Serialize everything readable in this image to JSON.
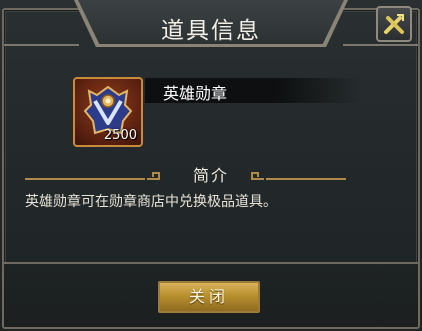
{
  "dialog": {
    "title": "道具信息",
    "close_icon": "close-x-icon"
  },
  "item": {
    "icon": "hero-medal-icon",
    "count": "2500",
    "name": "英雄勋章"
  },
  "section": {
    "label": "简介",
    "description": "英雄勋章可在勋章商店中兑换极品道具。"
  },
  "footer": {
    "close_label": "关闭"
  },
  "colors": {
    "accent_gold": "#c98a3c",
    "button_gold": "#b8902f",
    "frame": "#6f6a5f"
  }
}
